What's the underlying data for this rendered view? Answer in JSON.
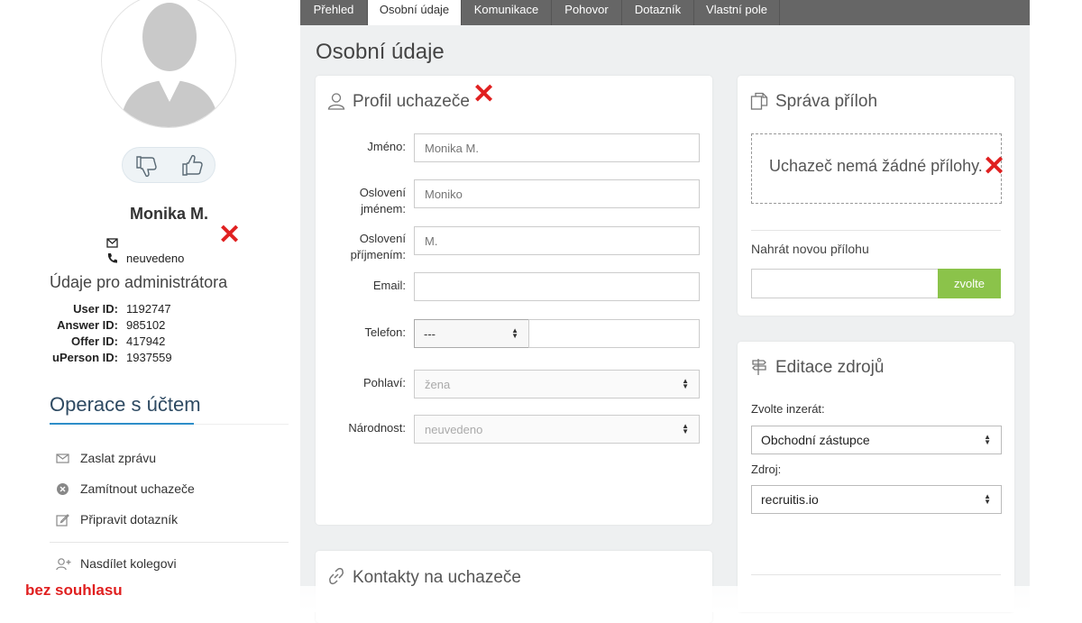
{
  "candidate": {
    "name": "Monika M.",
    "phone": "neuvedeno"
  },
  "admin": {
    "title": "Údaje pro administrátora",
    "fields": [
      {
        "label": "User ID:",
        "value": "1192747"
      },
      {
        "label": "Answer ID:",
        "value": "985102"
      },
      {
        "label": "Offer ID:",
        "value": "417942"
      },
      {
        "label": "uPerson ID:",
        "value": "1937559"
      }
    ]
  },
  "operations": {
    "title": "Operace s účtem",
    "items": [
      {
        "label": "Zaslat zprávu",
        "icon": "envelope-icon"
      },
      {
        "label": "Zamítnout uchazeče",
        "icon": "reject-circle-icon"
      },
      {
        "label": "Připravit dotazník",
        "icon": "edit-icon"
      },
      {
        "label": "Nasdílet kolegovi",
        "icon": "add-user-icon"
      }
    ]
  },
  "annotation": {
    "consent": "bez souhlasu",
    "mark": "✕"
  },
  "tabs": [
    {
      "label": "Přehled"
    },
    {
      "label": "Osobní údaje",
      "active": true
    },
    {
      "label": "Komunikace"
    },
    {
      "label": "Pohovor"
    },
    {
      "label": "Dotazník"
    },
    {
      "label": "Vlastní pole"
    }
  ],
  "page_title": "Osobní údaje",
  "profile": {
    "title": "Profil uchazeče",
    "fields": {
      "first_name": {
        "label": "Jméno:",
        "placeholder": "Monika M."
      },
      "salutation_first": {
        "label": "Oslovení jménem:",
        "placeholder": "Moniko"
      },
      "salutation_last": {
        "label": "Oslovení příjmením:",
        "placeholder": "M."
      },
      "email": {
        "label": "Email:",
        "value": ""
      },
      "phone": {
        "label": "Telefon:",
        "prefix": "---",
        "value": ""
      },
      "gender": {
        "label": "Pohlaví:",
        "value": "žena"
      },
      "nationality": {
        "label": "Národnost:",
        "value": "neuvedeno"
      }
    }
  },
  "attachments": {
    "title": "Správa příloh",
    "empty_text": "Uchazeč nemá žádné přílohy.",
    "upload_label": "Nahrát novou přílohu",
    "upload_button": "zvolte"
  },
  "sources": {
    "title": "Editace zdrojů",
    "ad_label": "Zvolte inzerát:",
    "ad_value": "Obchodní zástupce",
    "source_label": "Zdroj:",
    "source_value": "recruitis.io"
  },
  "contacts": {
    "title": "Kontakty na uchazeče"
  },
  "colors": {
    "accent": "#2e8ec9",
    "upload_button": "#8bc34a",
    "mark_red": "#e02020",
    "tabbar": "#666666"
  }
}
